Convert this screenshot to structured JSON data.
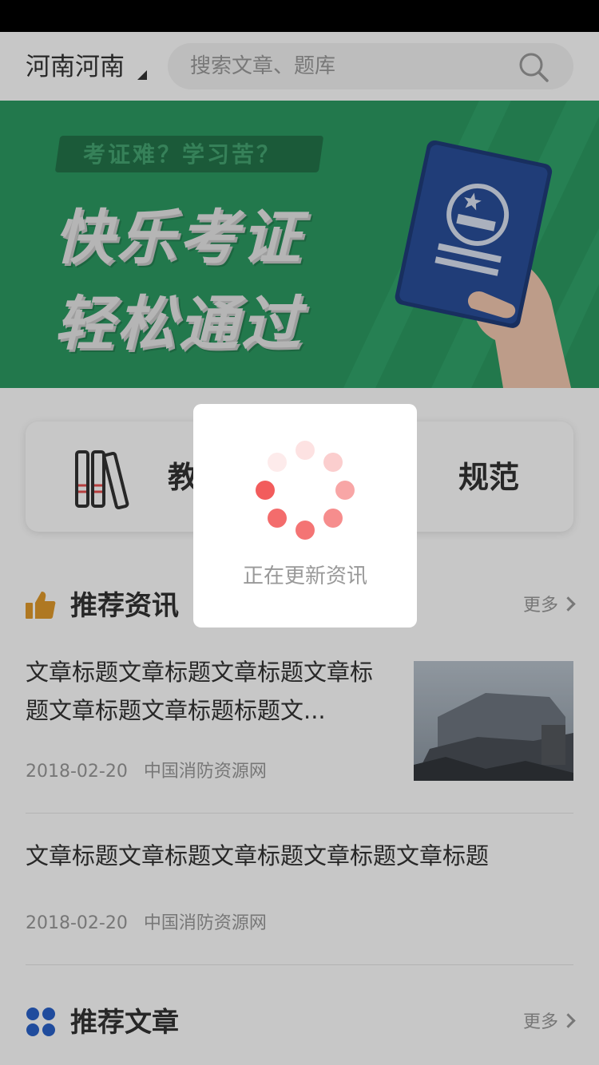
{
  "header": {
    "city": "河南河南",
    "search_placeholder": "搜索文章、题库"
  },
  "banner": {
    "tag": "考证难？学习苦？",
    "line1": "快乐考证",
    "line2": "轻松通过"
  },
  "quick_nav": {
    "left_label": "教",
    "right_label": "规范"
  },
  "news_section": {
    "title": "推荐资讯",
    "more": "更多",
    "articles": [
      {
        "title": "文章标题文章标题文章标题文章标题文章标题文章标题标题文...",
        "date": "2018-02-20",
        "source": "中国消防资源网"
      },
      {
        "title": "文章标题文章标题文章标题文章标题文章标题",
        "date": "2018-02-20",
        "source": "中国消防资源网"
      }
    ]
  },
  "articles_section": {
    "title": "推荐文章",
    "more": "更多"
  },
  "loading": {
    "text": "正在更新资讯"
  },
  "colors": {
    "banner_green": "#2c9a62",
    "spinner_red": "#f25c5c",
    "thumb_icon_orange": "#e09a2c",
    "grid_icon_blue": "#2a62c9"
  }
}
